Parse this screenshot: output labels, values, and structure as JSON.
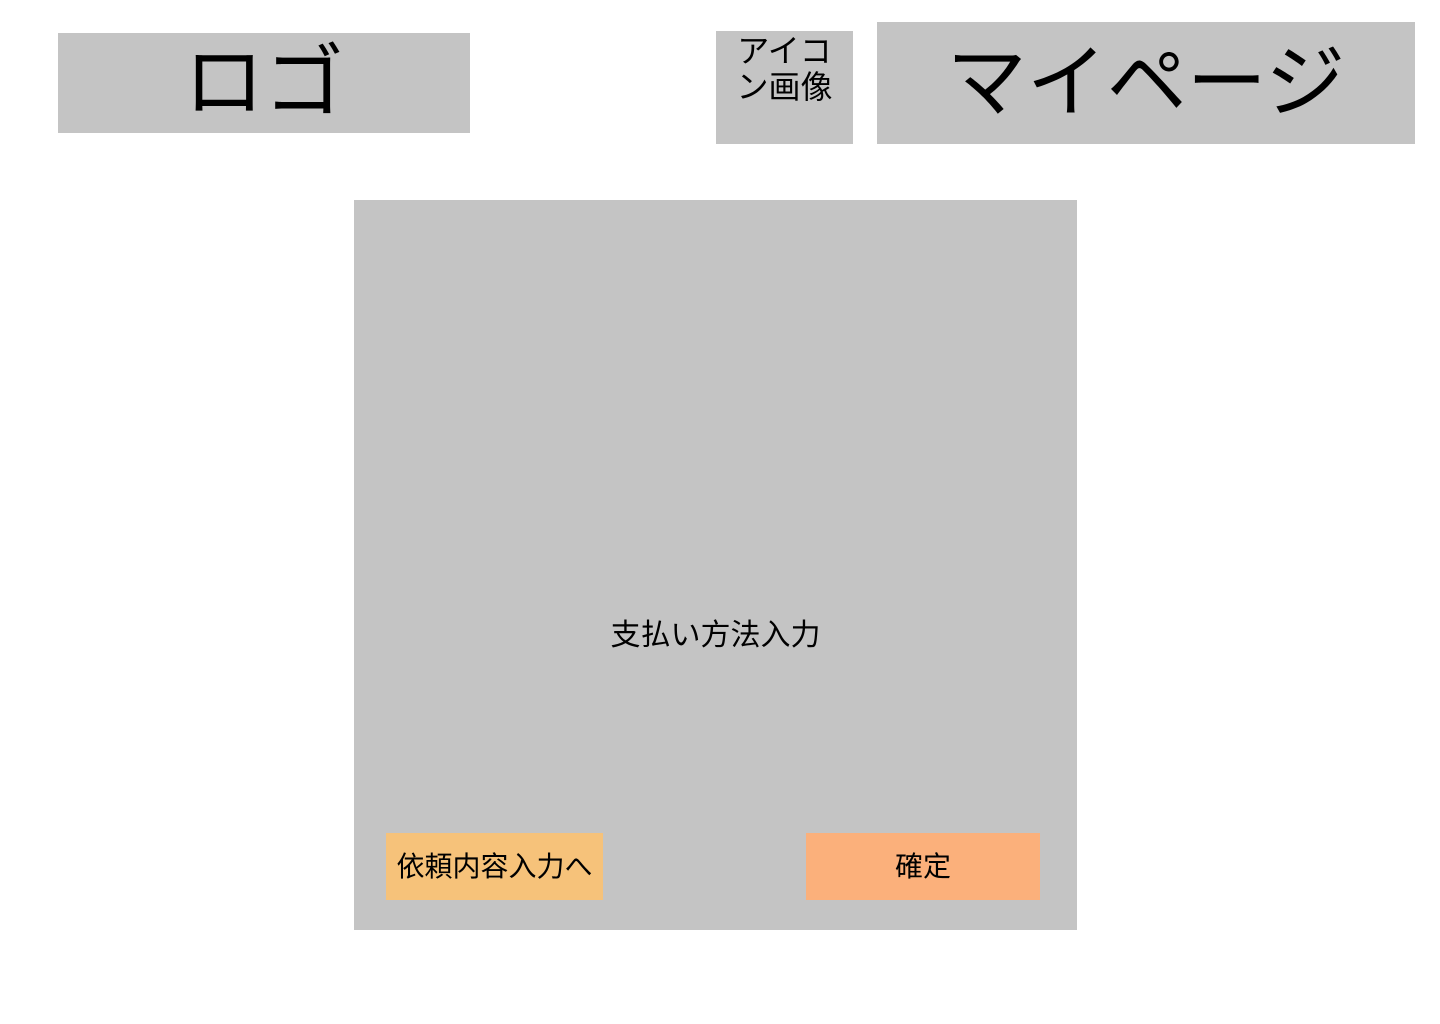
{
  "header": {
    "logo_label": "ロゴ",
    "avatar_label": "アイコン画像",
    "mypage_label": "マイページ"
  },
  "main": {
    "panel_title": "支払い方法入力",
    "back_button_label": "依頼内容入力へ",
    "confirm_button_label": "確定"
  },
  "colors": {
    "placeholder_gray": "#c4c4c4",
    "back_button": "#f6c27a",
    "confirm_button": "#fbb07b"
  }
}
